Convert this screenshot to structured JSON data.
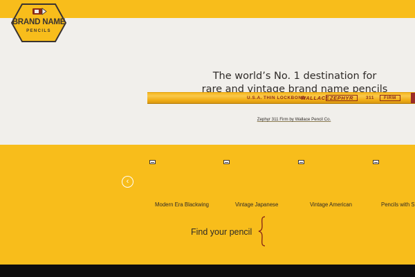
{
  "brand": {
    "name": "BRAND NAME",
    "subtitle": "PENCILS"
  },
  "hero": {
    "headline_line1": "The world’s No. 1 destination for",
    "headline_line2": "rare and vintage brand name pencils",
    "pencil_imprint": {
      "origin": "U.S.A.",
      "model_text": "THIN LOCKBOND",
      "maker": "WALLACE",
      "name": "ZEPHYR",
      "number": "311",
      "grade": "FIRM"
    },
    "caption": "Zephyr 311 Firm by Wallace Pencil Co."
  },
  "categories": [
    {
      "label": "Modern Era Blackwing",
      "icon": "pencil-thumbnail-icon"
    },
    {
      "label": "Vintage Japanese",
      "icon": "pencil-thumbnail-icon"
    },
    {
      "label": "Vintage American",
      "icon": "pencil-thumbnail-icon"
    },
    {
      "label": "Pencils with S",
      "icon": "pencil-thumbnail-icon"
    }
  ],
  "carousel": {
    "prev_icon": "chevron-left-icon"
  },
  "find": {
    "label": "Find your pencil"
  },
  "colors": {
    "brand_yellow": "#f8bd1b",
    "hero_background": "#f1efeb",
    "text_dark": "#2e2a27",
    "pencil_red": "#8a2a17",
    "footer": "#0e0d0d"
  }
}
